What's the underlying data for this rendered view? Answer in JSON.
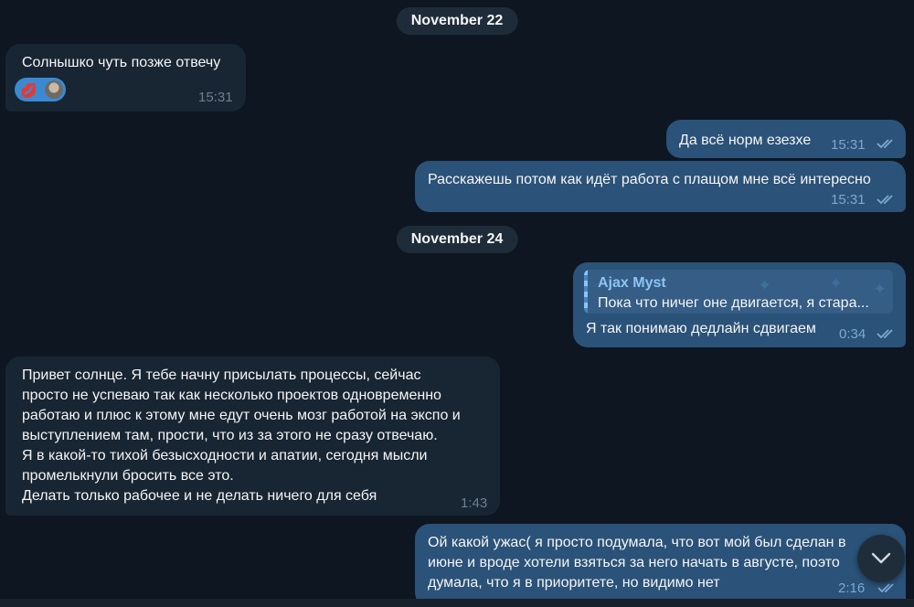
{
  "dates": [
    "November 22",
    "November 24"
  ],
  "messages": [
    {
      "direction": "in",
      "text": "Солнышко чуть позже отвечу",
      "time": "15:31",
      "reaction": "kiss-lips"
    },
    {
      "direction": "out",
      "text": "Да всё норм езезхе",
      "time": "15:31",
      "status": "read"
    },
    {
      "direction": "out",
      "text": "Расскажешь потом как идёт работа с плащом мне всё интересно",
      "time": "15:31",
      "status": "read"
    },
    {
      "direction": "out",
      "reply": {
        "name": "Ajax Myst",
        "text": "Пока что ничег оне двигается, я стара..."
      },
      "text": "Я так понимаю дедлайн сдвигаем",
      "time": "0:34",
      "status": "read"
    },
    {
      "direction": "in",
      "text": "Привет солнце. Я тебе начну присылать процессы, сейчас\nпросто не успеваю так как несколько проектов одновременно\nработаю и плюс к этому мне едут очень мозг работой на экспо и\nвыступлением там, прости, что из за этого не сразу отвечаю.\nЯ в какой-то тихой безысходности и апатии, сегодня мысли\nпромелькнули бросить все это.\nДелать только рабочее и не делать ничего для себя",
      "time": "1:43"
    },
    {
      "direction": "out",
      "text": "Ой какой ужас( я просто подумала, что вот мой был сделан в\nиюне и вроде хотели взяться за него начать в августе, поэто\nдумала, что я в приоритете, но видимо нет",
      "time": "2:16",
      "status": "read"
    }
  ],
  "colors": {
    "background": "#0e1621",
    "incoming": "#182533",
    "outgoing": "#2b5278",
    "accent": "#8cc4f5"
  },
  "icons": {
    "read_status": "double-check-icon",
    "scroll": "chevron-down-icon"
  }
}
